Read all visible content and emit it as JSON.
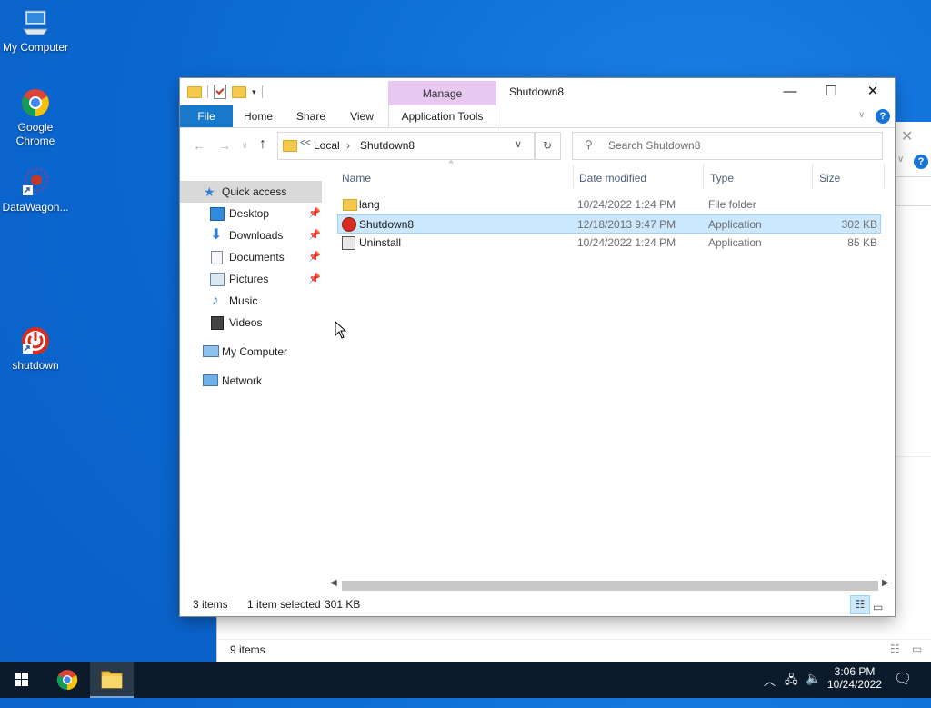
{
  "desktop": {
    "icons": [
      {
        "label": "My Computer",
        "name": "my-computer"
      },
      {
        "label": "Google Chrome",
        "name": "google-chrome"
      },
      {
        "label": "DataWagon...",
        "name": "datawagon"
      },
      {
        "label": "shutdown",
        "name": "shutdown"
      }
    ]
  },
  "window": {
    "title": "Shutdown8",
    "contextual_tab": "Manage",
    "ribbon_tabs": [
      "File",
      "Home",
      "Share",
      "View",
      "Application Tools"
    ],
    "address": {
      "overflow": "<<",
      "crumbs": [
        "Local",
        "Shutdown8"
      ]
    },
    "search_placeholder": "Search Shutdown8",
    "nav_pane": [
      {
        "label": "Quick access",
        "icon": "star-icon",
        "pinned": false,
        "selected": true
      },
      {
        "label": "Desktop",
        "icon": "desktop-icon",
        "pinned": true
      },
      {
        "label": "Downloads",
        "icon": "download-arrow-icon",
        "pinned": true
      },
      {
        "label": "Documents",
        "icon": "document-icon",
        "pinned": true
      },
      {
        "label": "Pictures",
        "icon": "picture-icon",
        "pinned": true
      },
      {
        "label": "Music",
        "icon": "music-note-icon",
        "pinned": false
      },
      {
        "label": "Videos",
        "icon": "film-icon",
        "pinned": false
      },
      {
        "label": "My Computer",
        "icon": "computer-icon",
        "pinned": false
      },
      {
        "label": "Network",
        "icon": "network-icon",
        "pinned": false
      }
    ],
    "columns": [
      "Name",
      "Date modified",
      "Type",
      "Size"
    ],
    "files": [
      {
        "name": "lang",
        "date": "10/24/2022 1:24 PM",
        "type": "File folder",
        "size": "",
        "icon": "folder-icon",
        "selected": false
      },
      {
        "name": "Shutdown8",
        "date": "12/18/2013 9:47 PM",
        "type": "Application",
        "size": "302 KB",
        "icon": "shutdown-app-icon",
        "selected": true
      },
      {
        "name": "Uninstall",
        "date": "10/24/2022 1:24 PM",
        "type": "Application",
        "size": "85 KB",
        "icon": "installer-icon",
        "selected": false
      }
    ],
    "status": {
      "items": "3 items",
      "selected": "1 item selected",
      "size": "301 KB"
    }
  },
  "background_window": {
    "status": "9 items"
  },
  "taskbar": {
    "time": "3:06 PM",
    "date": "10/24/2022"
  }
}
